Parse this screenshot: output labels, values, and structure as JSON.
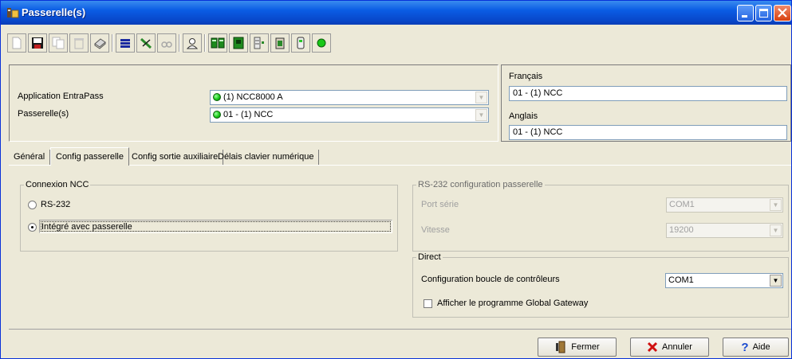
{
  "window": {
    "title": "Passerelle(s)"
  },
  "toolbar": {
    "icons": [
      "new-icon",
      "save-icon",
      "copy-icon",
      "delete-icon",
      "print-icon",
      "list-icon",
      "link-icon",
      "find-icon",
      "user-icon",
      "controller-icon",
      "board-icon",
      "components-icon",
      "door-icon",
      "reader-icon",
      "status-icon"
    ]
  },
  "header": {
    "app_label": "Application EntraPass",
    "app_value": "(1) NCC8000 A",
    "gw_label": "Passerelle(s)",
    "gw_value": "01 - (1) NCC",
    "fr_label": "Français",
    "fr_value": "01 - (1) NCC",
    "en_label": "Anglais",
    "en_value": "01 - (1) NCC"
  },
  "tabs": [
    "Général",
    "Config passerelle",
    "Config sortie auxiliaire",
    "Délais clavier numérique"
  ],
  "active_tab": "Config passerelle",
  "connexion": {
    "title": "Connexion NCC",
    "opt_rs232": "RS-232",
    "opt_integrated": "Intégré avec passerelle",
    "selected": "Intégré avec passerelle"
  },
  "rs232": {
    "title": "RS-232 configuration passerelle",
    "port_label": "Port série",
    "port_value": "COM1",
    "speed_label": "Vitesse",
    "speed_value": "19200"
  },
  "direct": {
    "title": "Direct",
    "loop_label": "Configuration boucle de contrôleurs",
    "loop_value": "COM1",
    "show_label": "Afficher le programme Global Gateway",
    "show_checked": false
  },
  "buttons": {
    "close": "Fermer",
    "cancel": "Annuler",
    "help": "Aide"
  },
  "colors": {
    "titlebar": "#0a5ce4",
    "status_green": "#18c818",
    "face": "#ece9d8"
  }
}
